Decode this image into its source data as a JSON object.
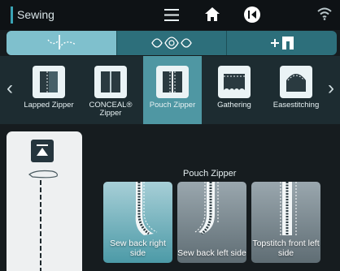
{
  "header": {
    "title": "Sewing",
    "icons": [
      "menu-icon",
      "home-icon",
      "back-icon",
      "wifi-icon"
    ]
  },
  "tabs": [
    {
      "name": "needle-stitch-tab",
      "active": true
    },
    {
      "name": "decorative-stitch-tab",
      "active": false
    },
    {
      "name": "font-stitch-tab",
      "active": false
    }
  ],
  "stitches": [
    {
      "label": "Lapped Zipper",
      "active": false
    },
    {
      "label": "CONCEAL® Zipper",
      "active": false
    },
    {
      "label": "Pouch Zipper",
      "active": true
    },
    {
      "label": "Gathering",
      "active": false
    },
    {
      "label": "Easestitching",
      "active": false
    }
  ],
  "section": {
    "title": "Pouch Zipper"
  },
  "options": [
    {
      "label": "Sew back right side",
      "selected": true
    },
    {
      "label": "Sew back left side",
      "selected": false
    },
    {
      "label": "Topstitch front left side",
      "selected": false
    }
  ],
  "colors": {
    "accent": "#3aa3b4",
    "tab_active": "#7fc0cd",
    "stitch_active": "#4f97a3"
  }
}
